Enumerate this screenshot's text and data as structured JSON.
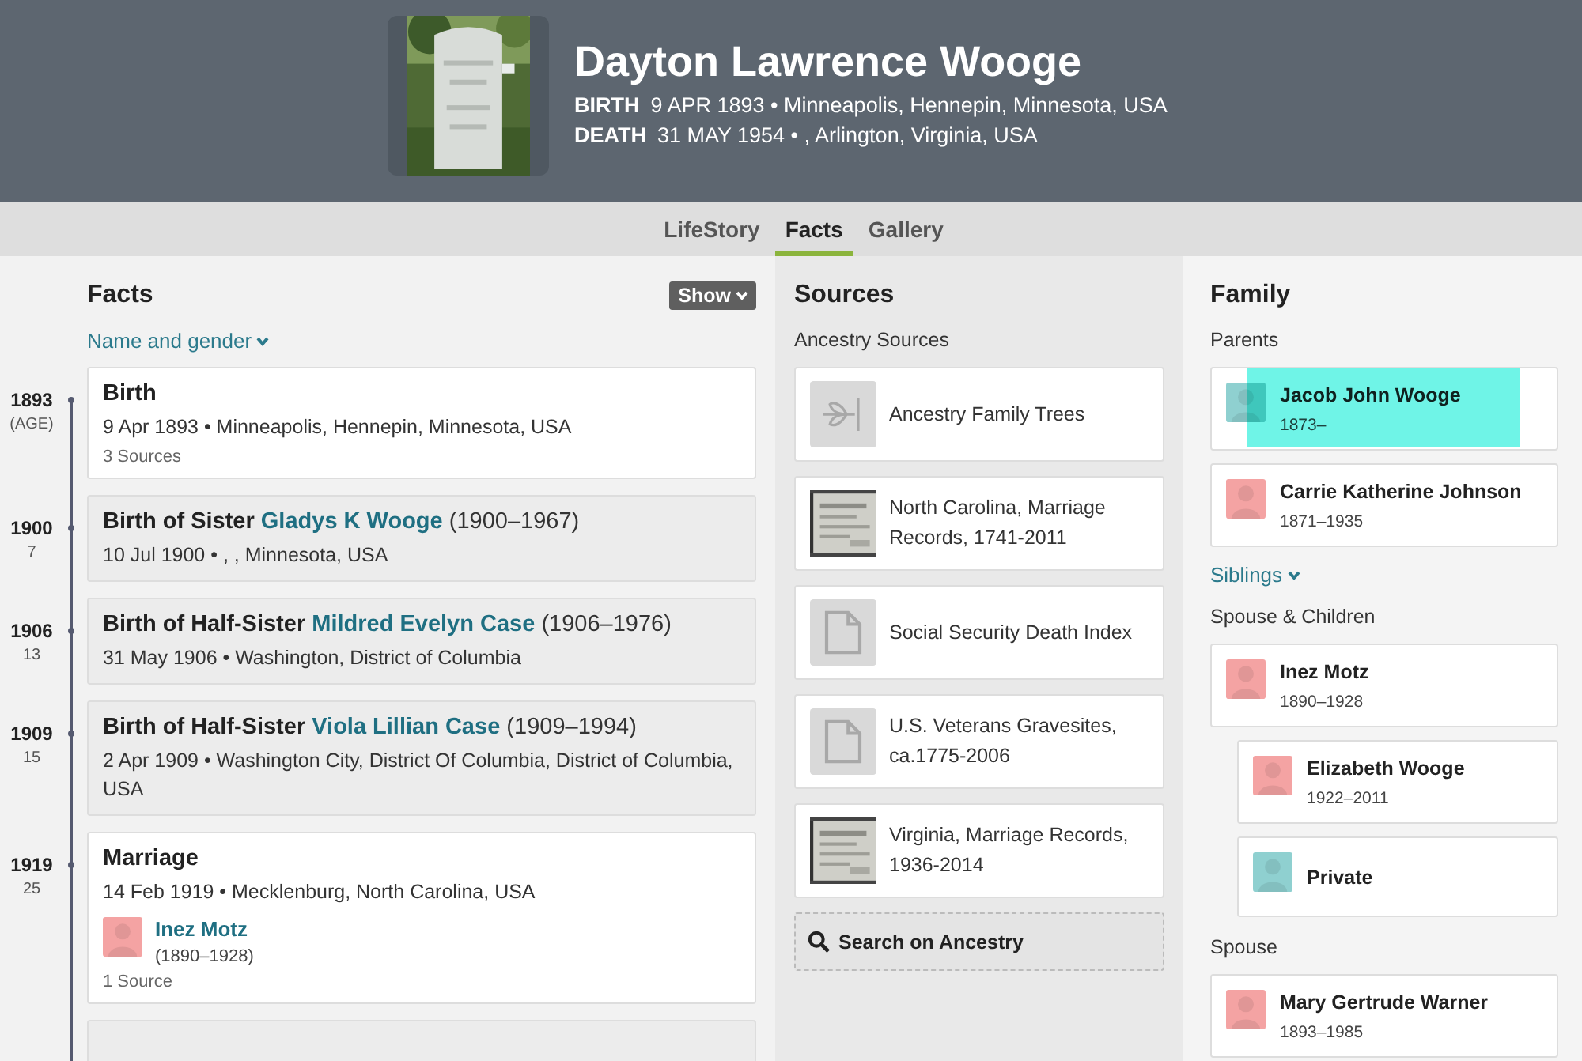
{
  "person": {
    "name": "Dayton Lawrence Wooge",
    "birth_label": "BIRTH",
    "birth": "9 APR 1893 • Minneapolis, Hennepin, Minnesota, USA",
    "death_label": "DEATH",
    "death": "31 MAY 1954 • , Arlington, Virginia, USA"
  },
  "tabs": [
    {
      "label": "LifeStory",
      "selected": false
    },
    {
      "label": "Facts",
      "selected": true
    },
    {
      "label": "Gallery",
      "selected": false
    }
  ],
  "facts": {
    "title": "Facts",
    "show_button": "Show",
    "filter_link": "Name and gender",
    "events": [
      {
        "year": "1893",
        "age": "(AGE)",
        "kind": "personal",
        "title": "Birth",
        "detail": "9 Apr 1893 • Minneapolis, Hennepin, Minnesota, USA",
        "sources": "3 Sources"
      },
      {
        "year": "1900",
        "age": "7",
        "kind": "family",
        "title": "Birth of Sister",
        "person": "Gladys K Wooge",
        "dates": "(1900–1967)",
        "detail": "10 Jul 1900 • , , Minnesota, USA"
      },
      {
        "year": "1906",
        "age": "13",
        "kind": "family",
        "title": "Birth of Half-Sister",
        "person": "Mildred Evelyn Case",
        "dates": "(1906–1976)",
        "detail": "31 May 1906 • Washington, District of Columbia"
      },
      {
        "year": "1909",
        "age": "15",
        "kind": "family",
        "title": "Birth of Half-Sister",
        "person": "Viola Lillian Case",
        "dates": "(1909–1994)",
        "detail": "2 Apr 1909 • Washington City, District Of Columbia, District of Columbia, USA"
      },
      {
        "year": "1919",
        "age": "25",
        "kind": "personal",
        "title": "Marriage",
        "detail": "14 Feb 1919 • Mecklenburg, North Carolina, USA",
        "spouse": {
          "name": "Inez Motz",
          "dates": "(1890–1928)",
          "color": "#f4a3a3"
        },
        "sources": "1 Source"
      },
      {
        "kind": "family"
      }
    ]
  },
  "sources": {
    "title": "Sources",
    "subtitle": "Ancestry Sources",
    "items": [
      {
        "kind": "tree",
        "label": "Ancestry Family Trees"
      },
      {
        "label": "North Carolina, Marriage Records, 1741-2011"
      },
      {
        "kind": "document",
        "label": "Social Security Death Index"
      },
      {
        "kind": "document",
        "label": "U.S. Veterans Gravesites, ca.1775-2006"
      },
      {
        "label": "Virginia, Marriage Records, 1936-2014"
      }
    ],
    "search_button": "Search on Ancestry"
  },
  "family": {
    "title": "Family",
    "sections": [
      {
        "kind": "heading",
        "label": "Parents"
      },
      {
        "kind": "person",
        "name": "Jacob John Wooge",
        "dates": "1873–",
        "color": "#8fd0d0",
        "highlighted": true,
        "indented": false
      },
      {
        "kind": "person",
        "name": "Carrie Katherine Johnson",
        "dates": "1871–1935",
        "color": "#f4a3a3",
        "highlighted": false,
        "indented": false
      },
      {
        "kind": "link",
        "label": "Siblings"
      },
      {
        "kind": "heading",
        "label": "Spouse & Children"
      },
      {
        "kind": "person",
        "name": "Inez Motz",
        "dates": "1890–1928",
        "color": "#f4a3a3",
        "highlighted": false,
        "indented": false
      },
      {
        "kind": "person",
        "name": "Elizabeth Wooge",
        "dates": "1922–2011",
        "color": "#f4a3a3",
        "highlighted": false,
        "indented": true
      },
      {
        "kind": "person",
        "name": "Private",
        "color": "#8fd0d0",
        "highlighted": false,
        "indented": true
      },
      {
        "kind": "heading",
        "label": "Spouse"
      },
      {
        "kind": "person",
        "name": "Mary Gertrude Warner",
        "dates": "1893–1985",
        "color": "#f4a3a3",
        "highlighted": false,
        "indented": false
      }
    ]
  }
}
